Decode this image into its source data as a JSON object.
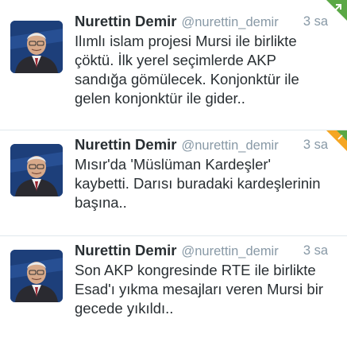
{
  "tweets": [
    {
      "name": "Nurettin Demir",
      "handle": "@nurettin_demir",
      "time": "3 sa",
      "text": "Ilımlı islam projesi Mursi ile birlikte\nçöktü. İlk yerel seçimlerde AKP\nsandığa gömülecek. Konjonktür ile\ngelen konjonktür ile gider..",
      "corner": "retweeted-corner-icon",
      "corner_color": "#5aa845"
    },
    {
      "name": "Nurettin Demir",
      "handle": "@nurettin_demir",
      "time": "3 sa",
      "text": "Mısır'da 'Müslüman Kardeşler'\nkaybetti. Darısı buradaki kardeşlerinin\nbaşına..",
      "corner": "retweeted-favorited-corner-icon",
      "corner_color": "#f5a623"
    },
    {
      "name": "Nurettin Demir",
      "handle": "@nurettin_demir",
      "time": "3 sa",
      "text": "Son AKP kongresinde RTE ile birlikte\nEsad'ı yıkma mesajları veren Mursi bir\ngecede yıkıldı..",
      "corner": "",
      "corner_color": ""
    }
  ],
  "colors": {
    "avatar_bg": "#1d3f7a",
    "divider": "#e1e8ed",
    "meta_text": "#8899a6",
    "body_text": "#292f33"
  }
}
